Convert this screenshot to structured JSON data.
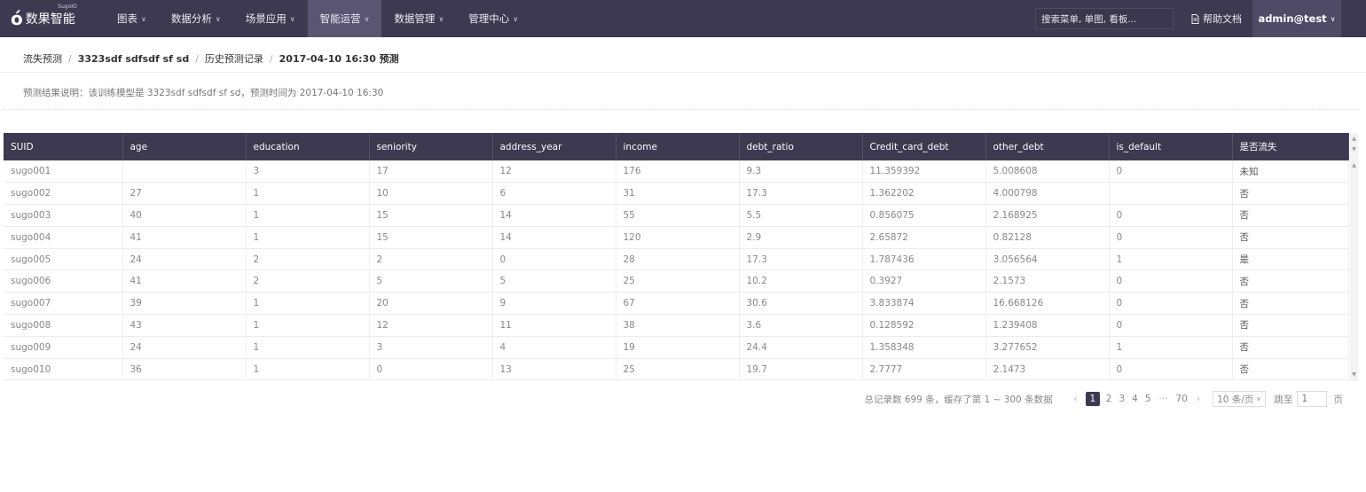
{
  "brand": {
    "name": "数果智能",
    "sup": "SugoIO",
    "mark": "ó"
  },
  "nav": [
    {
      "label": "图表",
      "active": false
    },
    {
      "label": "数据分析",
      "active": false
    },
    {
      "label": "场景应用",
      "active": false
    },
    {
      "label": "智能运营",
      "active": true
    },
    {
      "label": "数据管理",
      "active": false
    },
    {
      "label": "管理中心",
      "active": false
    }
  ],
  "search": {
    "placeholder": "搜索菜单, 单图, 看板..."
  },
  "help": {
    "label": "帮助文档",
    "icon": "document-icon"
  },
  "user": {
    "label": "admin@test"
  },
  "breadcrumb": [
    "流失预测",
    "3323sdf sdfsdf sf sd",
    "历史预测记录",
    "2017-04-10 16:30 预测"
  ],
  "description": "预测结果说明：该训练模型是 3323sdf sdfsdf sf sd，预测时间为 2017-04-10 16:30",
  "table": {
    "columns": [
      "SUID",
      "age",
      "education",
      "seniority",
      "address_year",
      "income",
      "debt_ratio",
      "Credit_card_debt",
      "other_debt",
      "is_default",
      "是否流失"
    ],
    "rows": [
      [
        "sugo001",
        "",
        "3",
        "17",
        "12",
        "176",
        "9.3",
        "11.359392",
        "5.008608",
        "0",
        "未知"
      ],
      [
        "sugo002",
        "27",
        "1",
        "10",
        "6",
        "31",
        "17.3",
        "1.362202",
        "4.000798",
        "",
        "否"
      ],
      [
        "sugo003",
        "40",
        "1",
        "15",
        "14",
        "55",
        "5.5",
        "0.856075",
        "2.168925",
        "0",
        "否"
      ],
      [
        "sugo004",
        "41",
        "1",
        "15",
        "14",
        "120",
        "2.9",
        "2.65872",
        "0.82128",
        "0",
        "否"
      ],
      [
        "sugo005",
        "24",
        "2",
        "2",
        "0",
        "28",
        "17.3",
        "1.787436",
        "3.056564",
        "1",
        "是"
      ],
      [
        "sugo006",
        "41",
        "2",
        "5",
        "5",
        "25",
        "10.2",
        "0.3927",
        "2.1573",
        "0",
        "否"
      ],
      [
        "sugo007",
        "39",
        "1",
        "20",
        "9",
        "67",
        "30.6",
        "3.833874",
        "16.668126",
        "0",
        "否"
      ],
      [
        "sugo008",
        "43",
        "1",
        "12",
        "11",
        "38",
        "3.6",
        "0.128592",
        "1.239408",
        "0",
        "否"
      ],
      [
        "sugo009",
        "24",
        "1",
        "3",
        "4",
        "19",
        "24.4",
        "1.358348",
        "3.277652",
        "1",
        "否"
      ],
      [
        "sugo010",
        "36",
        "1",
        "0",
        "13",
        "25",
        "19.7",
        "2.7777",
        "2.1473",
        "0",
        "否"
      ]
    ]
  },
  "pagination": {
    "total_text": "总记录数 699 条，缓存了第 1 ~ 300 条数据",
    "pages": [
      "1",
      "2",
      "3",
      "4",
      "5"
    ],
    "current": "1",
    "ellipsis": "···",
    "last": "70",
    "prev": "‹",
    "next": "›",
    "page_size": "10 条/页",
    "jump_label": "跳至",
    "jump_value": "1",
    "page_suffix": "页"
  },
  "colors": {
    "nav_bg": "#3d3950",
    "nav_active": "#5a5573",
    "header_bg": "#3d3950"
  }
}
